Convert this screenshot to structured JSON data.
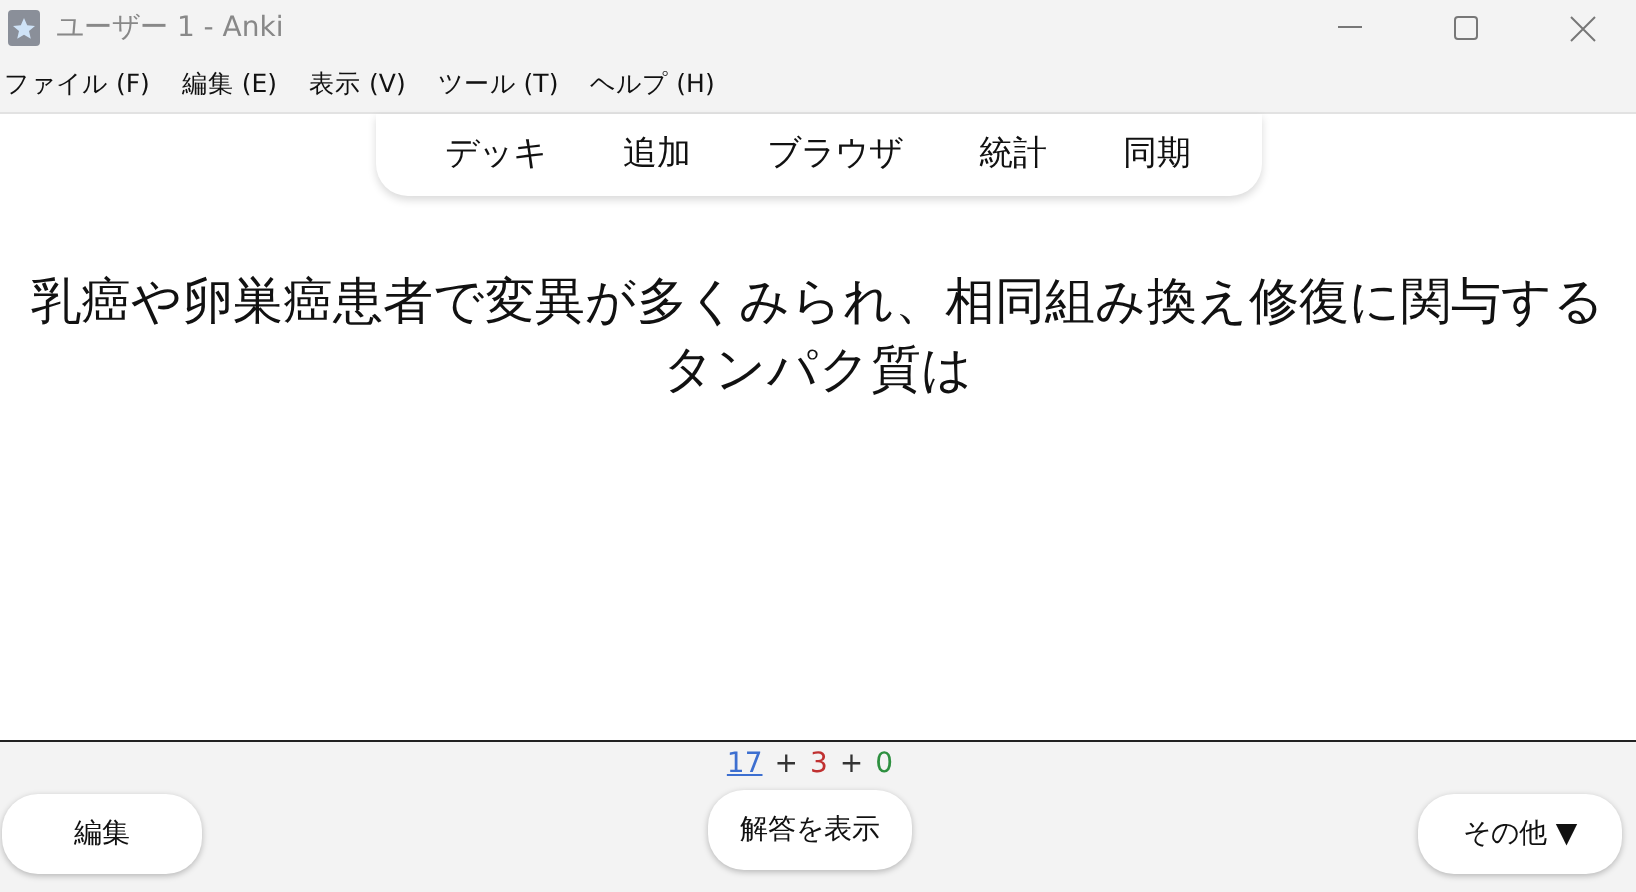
{
  "window": {
    "title": "ユーザー 1 - Anki"
  },
  "menu": [
    "ファイル (F)",
    "編集 (E)",
    "表示 (V)",
    "ツール (T)",
    "ヘルプ (H)"
  ],
  "toolbar": [
    "デッキ",
    "追加",
    "ブラウザ",
    "統計",
    "同期"
  ],
  "card": {
    "question": "乳癌や卵巣癌患者で変異が多くみられ、相同組み換え修復に関与するタンパク質は"
  },
  "counts": [
    {
      "value": "17",
      "color": "#3d6fd0",
      "selected": true
    },
    {
      "value": "3",
      "color": "#c03030",
      "selected": false
    },
    {
      "value": "0",
      "color": "#2e9040",
      "selected": false
    }
  ],
  "count_separators": [
    "+",
    "+"
  ],
  "buttons": {
    "edit": "編集",
    "show_answer": "解答を表示",
    "more": "その他 ▼"
  }
}
